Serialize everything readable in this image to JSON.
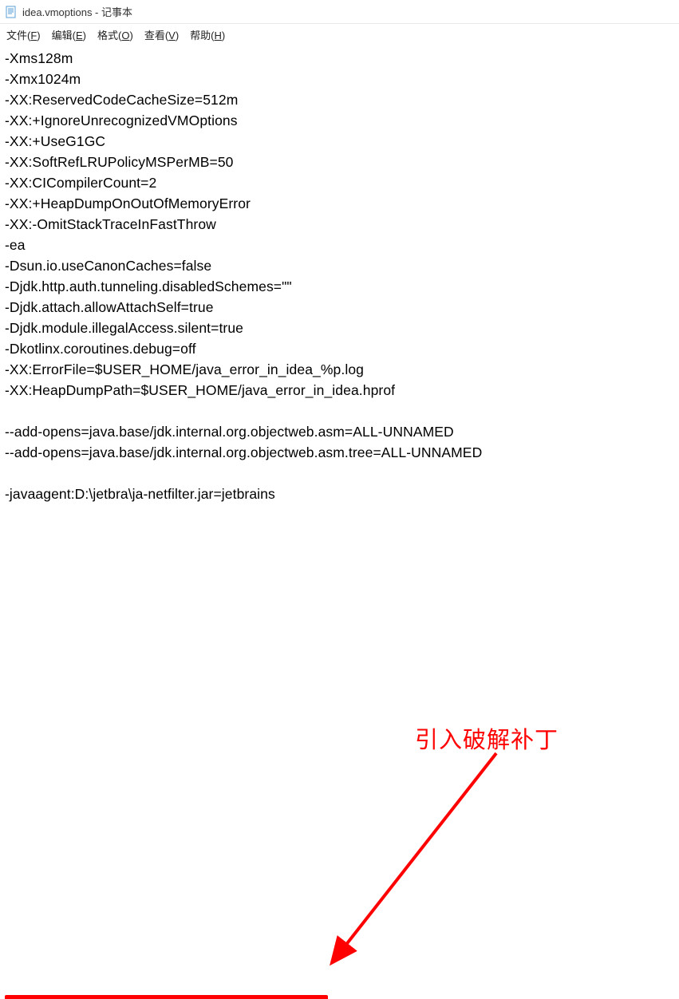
{
  "window": {
    "title": "idea.vmoptions - 记事本"
  },
  "menu": {
    "file": "文件(F)",
    "edit": "编辑(E)",
    "format": "格式(O)",
    "view": "查看(V)",
    "help": "帮助(H)"
  },
  "content": {
    "lines": [
      "-Xms128m",
      "-Xmx1024m",
      "-XX:ReservedCodeCacheSize=512m",
      "-XX:+IgnoreUnrecognizedVMOptions",
      "-XX:+UseG1GC",
      "-XX:SoftRefLRUPolicyMSPerMB=50",
      "-XX:CICompilerCount=2",
      "-XX:+HeapDumpOnOutOfMemoryError",
      "-XX:-OmitStackTraceInFastThrow",
      "-ea",
      "-Dsun.io.useCanonCaches=false",
      "-Djdk.http.auth.tunneling.disabledSchemes=\"\"",
      "-Djdk.attach.allowAttachSelf=true",
      "-Djdk.module.illegalAccess.silent=true",
      "-Dkotlinx.coroutines.debug=off",
      "-XX:ErrorFile=$USER_HOME/java_error_in_idea_%p.log",
      "-XX:HeapDumpPath=$USER_HOME/java_error_in_idea.hprof",
      "",
      "--add-opens=java.base/jdk.internal.org.objectweb.asm=ALL-UNNAMED",
      "--add-opens=java.base/jdk.internal.org.objectweb.asm.tree=ALL-UNNAMED",
      "",
      "-javaagent:D:\\jetbra\\ja-netfilter.jar=jetbrains"
    ]
  },
  "annotation": {
    "label": "引入破解补丁"
  }
}
